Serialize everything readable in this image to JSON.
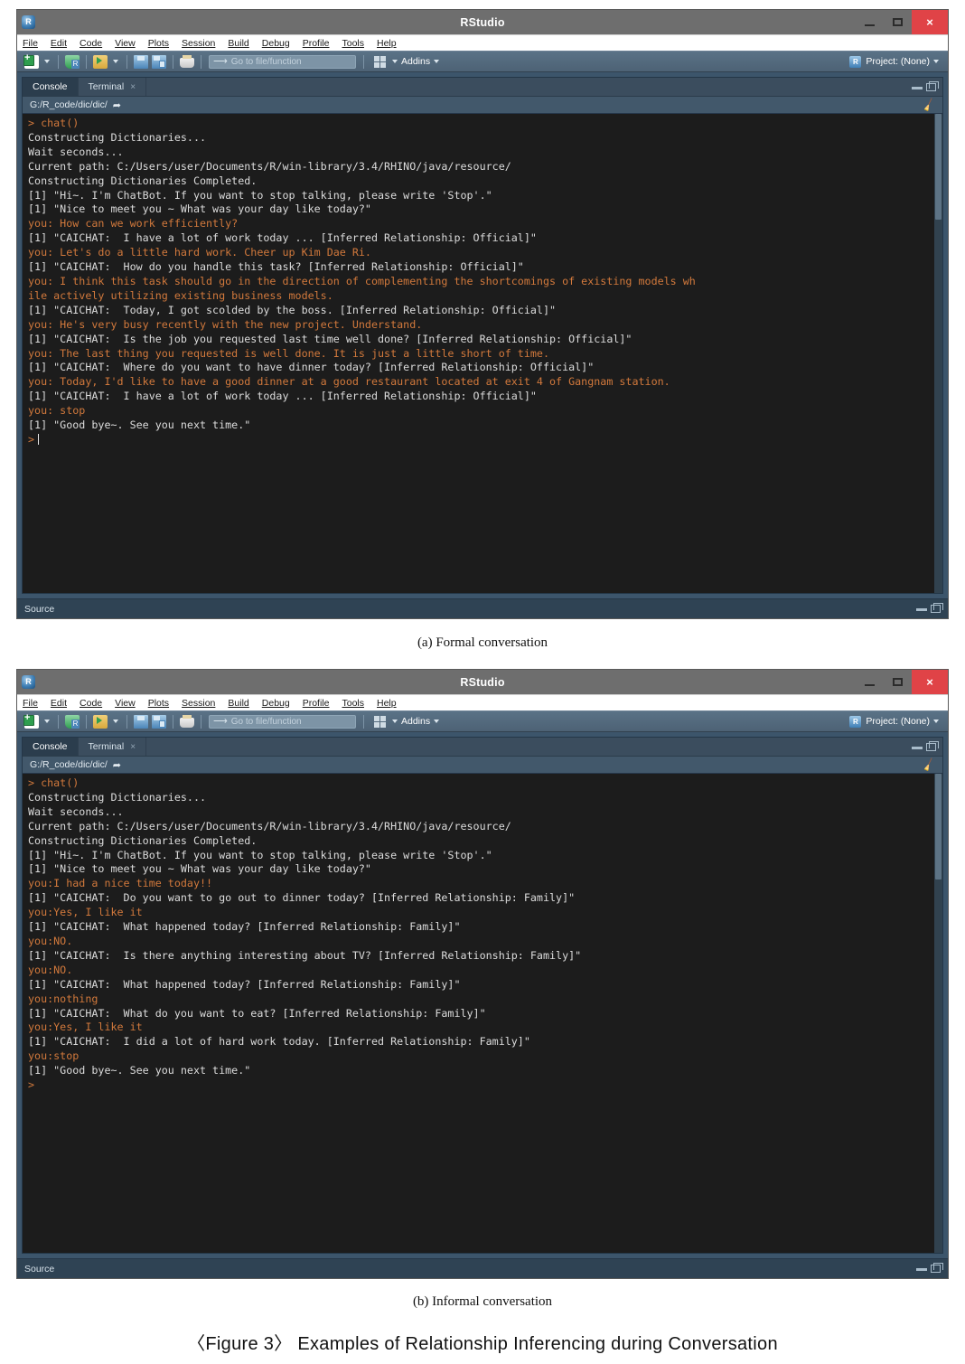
{
  "window": {
    "title": "RStudio",
    "app_icon": "rstudio-logo-icon",
    "controls": {
      "minimize": "minimize-icon",
      "maximize": "maximize-icon",
      "close": "×"
    }
  },
  "menubar": {
    "items": [
      "File",
      "Edit",
      "Code",
      "View",
      "Plots",
      "Session",
      "Build",
      "Debug",
      "Profile",
      "Tools",
      "Help"
    ]
  },
  "toolbar": {
    "goto_placeholder": "Go to file/function",
    "addins_label": "Addins",
    "project_label": "Project: (None)",
    "icons": [
      "new-file-icon",
      "new-project-icon",
      "open-file-icon",
      "save-icon",
      "save-all-icon",
      "print-icon",
      "addins-grid-icon"
    ]
  },
  "pane": {
    "tabs": [
      {
        "label": "Console",
        "active": true,
        "closable": false
      },
      {
        "label": "Terminal",
        "active": false,
        "closable": true,
        "close_glyph": "×"
      }
    ],
    "path": "G:/R_code/dic/dic/",
    "path_shortcut_icon": "open-in-new-window-icon",
    "clear_icon": "broom-icon",
    "status_label": "Source"
  },
  "console_a": {
    "lines": [
      {
        "text": "> chat()",
        "style": "cmd"
      },
      {
        "text": "Constructing Dictionaries...",
        "style": "out"
      },
      {
        "text": "Wait seconds...",
        "style": "out"
      },
      {
        "text": "Current path: C:/Users/user/Documents/R/win-library/3.4/RHINO/java/resource/",
        "style": "out"
      },
      {
        "text": "Constructing Dictionaries Completed.",
        "style": "out"
      },
      {
        "text": "[1] \"Hi~. I'm ChatBot. If you want to stop talking, please write 'Stop'.\"",
        "style": "out"
      },
      {
        "text": "[1] \"Nice to meet you ~ What was your day like today?\"",
        "style": "out"
      },
      {
        "text": "you: How can we work efficiently?",
        "style": "you"
      },
      {
        "text": "[1] \"CAICHAT:  I have a lot of work today ... [Inferred Relationship: Official]\"",
        "style": "out"
      },
      {
        "text": "you: Let's do a little hard work. Cheer up Kim Dae Ri.",
        "style": "you"
      },
      {
        "text": "[1] \"CAICHAT:  How do you handle this task? [Inferred Relationship: Official]\"",
        "style": "out"
      },
      {
        "text": "you: I think this task should go in the direction of complementing the shortcomings of existing models wh",
        "style": "you"
      },
      {
        "text": "ile actively utilizing existing business models.",
        "style": "you"
      },
      {
        "text": "[1] \"CAICHAT:  Today, I got scolded by the boss. [Inferred Relationship: Official]\"",
        "style": "out"
      },
      {
        "text": "you: He's very busy recently with the new project. Understand.",
        "style": "you"
      },
      {
        "text": "[1] \"CAICHAT:  Is the job you requested last time well done? [Inferred Relationship: Official]\"",
        "style": "out"
      },
      {
        "text": "you: The last thing you requested is well done. It is just a little short of time.",
        "style": "you"
      },
      {
        "text": "[1] \"CAICHAT:  Where do you want to have dinner today? [Inferred Relationship: Official]\"",
        "style": "out"
      },
      {
        "text": "you: Today, I'd like to have a good dinner at a good restaurant located at exit 4 of Gangnam station.",
        "style": "you"
      },
      {
        "text": "[1] \"CAICHAT:  I have a lot of work today ... [Inferred Relationship: Official]\"",
        "style": "out"
      },
      {
        "text": "you: stop",
        "style": "you"
      },
      {
        "text": "[1] \"Good bye~. See you next time.\"",
        "style": "out"
      },
      {
        "text": ">",
        "style": "cmd",
        "cursor": true
      }
    ]
  },
  "console_b": {
    "lines": [
      {
        "text": "> chat()",
        "style": "cmd"
      },
      {
        "text": "Constructing Dictionaries...",
        "style": "out"
      },
      {
        "text": "Wait seconds...",
        "style": "out"
      },
      {
        "text": "Current path: C:/Users/user/Documents/R/win-library/3.4/RHINO/java/resource/",
        "style": "out"
      },
      {
        "text": "Constructing Dictionaries Completed.",
        "style": "out"
      },
      {
        "text": "[1] \"Hi~. I'm ChatBot. If you want to stop talking, please write 'Stop'.\"",
        "style": "out"
      },
      {
        "text": "[1] \"Nice to meet you ~ What was your day like today?\"",
        "style": "out"
      },
      {
        "text": "you:I had a nice time today!!",
        "style": "you"
      },
      {
        "text": "[1] \"CAICHAT:  Do you want to go out to dinner today? [Inferred Relationship: Family]\"",
        "style": "out"
      },
      {
        "text": "you:Yes, I like it",
        "style": "you"
      },
      {
        "text": "[1] \"CAICHAT:  What happened today? [Inferred Relationship: Family]\"",
        "style": "out"
      },
      {
        "text": "you:NO.",
        "style": "you"
      },
      {
        "text": "[1] \"CAICHAT:  Is there anything interesting about TV? [Inferred Relationship: Family]\"",
        "style": "out"
      },
      {
        "text": "you:NO.",
        "style": "you"
      },
      {
        "text": "[1] \"CAICHAT:  What happened today? [Inferred Relationship: Family]\"",
        "style": "out"
      },
      {
        "text": "you:nothing",
        "style": "you"
      },
      {
        "text": "[1] \"CAICHAT:  What do you want to eat? [Inferred Relationship: Family]\"",
        "style": "out"
      },
      {
        "text": "you:Yes, I like it",
        "style": "you"
      },
      {
        "text": "[1] \"CAICHAT:  I did a lot of hard work today. [Inferred Relationship: Family]\"",
        "style": "out"
      },
      {
        "text": "you:stop",
        "style": "you"
      },
      {
        "text": "[1] \"Good bye~. See you next time.\"",
        "style": "out"
      },
      {
        "text": ">",
        "style": "cmd"
      }
    ]
  },
  "captions": {
    "a": "(a)  Formal  conversation",
    "b": "(b)  Informal  conversation",
    "figure": "〈Figure 3〉 Examples of Relationship Inferencing during Conversation"
  },
  "colors": {
    "console_bg": "#1c1c1c",
    "console_text": "#dcdcdc",
    "user_text": "#d2793c",
    "title_bar": "#6e6e6e",
    "close_button": "#e04347",
    "toolbar": "#51697d",
    "pane_bg": "#2b3d4d",
    "app_bg": "#3c556b"
  }
}
